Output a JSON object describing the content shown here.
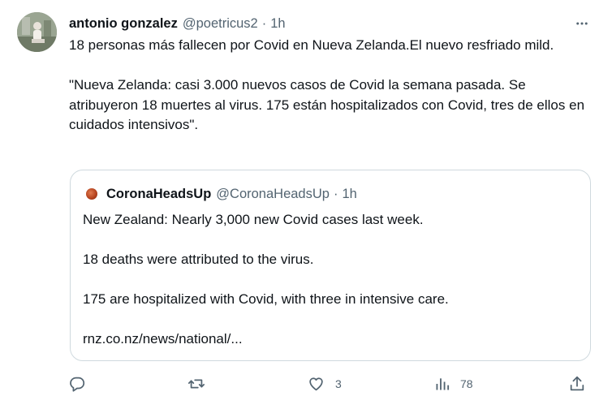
{
  "tweet": {
    "author_name": "antonio gonzalez",
    "author_handle": "@poetricus2",
    "separator": "·",
    "time": "1h",
    "more_icon": "more-horizontal-icon",
    "text_paragraphs": [
      "18 personas más fallecen por Covid en Nueva Zelanda.El nuevo resfriado mild.",
      "\"Nueva Zelanda: casi 3.000 nuevos casos de Covid la semana pasada. Se atribuyeron 18 muertes al virus. 175 están hospitalizados con Covid, tres de ellos en cuidados intensivos\"."
    ]
  },
  "quoted_tweet": {
    "author_name": "CoronaHeadsUp",
    "author_handle": "@CoronaHeadsUp",
    "separator": "·",
    "time": "1h",
    "text_paragraphs": [
      "New Zealand:  Nearly 3,000 new Covid cases last week.",
      "18 deaths were attributed to the virus.",
      "175 are hospitalized with Covid, with three in intensive care.",
      "rnz.co.nz/news/national/..."
    ]
  },
  "actions": {
    "reply": {
      "icon": "reply-icon",
      "count": ""
    },
    "retweet": {
      "icon": "retweet-icon",
      "count": ""
    },
    "like": {
      "icon": "heart-icon",
      "count": "3"
    },
    "views": {
      "icon": "views-chart-icon",
      "count": "78"
    },
    "share": {
      "icon": "share-icon",
      "count": ""
    }
  },
  "colors": {
    "text_primary": "#0f1419",
    "text_secondary": "#536471",
    "border": "#cfd9de",
    "background": "#ffffff"
  }
}
